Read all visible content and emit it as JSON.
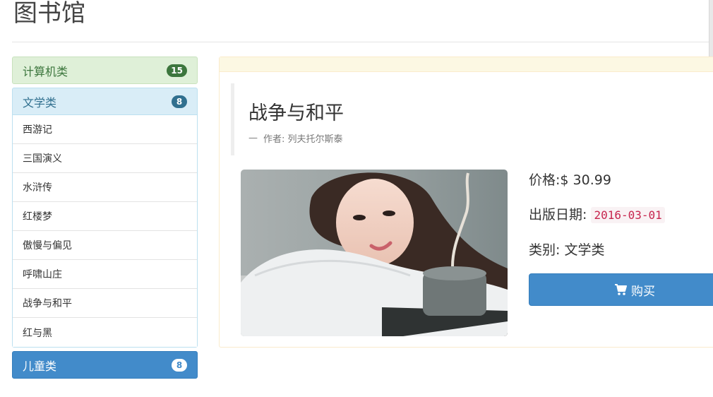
{
  "header": {
    "title": "图书馆"
  },
  "sidebar": {
    "categories": [
      {
        "label": "计算机类",
        "count": "15"
      },
      {
        "label": "文学类",
        "count": "8",
        "books": [
          "西游记",
          "三国演义",
          "水浒传",
          "红楼梦",
          "傲慢与偏见",
          "呼啸山庄",
          "战争与和平",
          "红与黑"
        ]
      },
      {
        "label": "儿童类",
        "count": "8"
      }
    ]
  },
  "book": {
    "title": "战争与和平",
    "author_dash": "—",
    "author": "作者: 列夫托尔斯泰",
    "price_label": "价格:",
    "price": "$ 30.99",
    "date_label": "出版日期:",
    "date": "2016-03-01",
    "category_label": "类别:",
    "category": "文学类",
    "buy_label": "购买",
    "cover_icon": "cover-photo"
  },
  "colors": {
    "primary": "#428bca",
    "success_bg": "#dff0d8",
    "info_bg": "#d9edf7",
    "warning_bg": "#fcf8e3",
    "code_text": "#c7254e"
  }
}
